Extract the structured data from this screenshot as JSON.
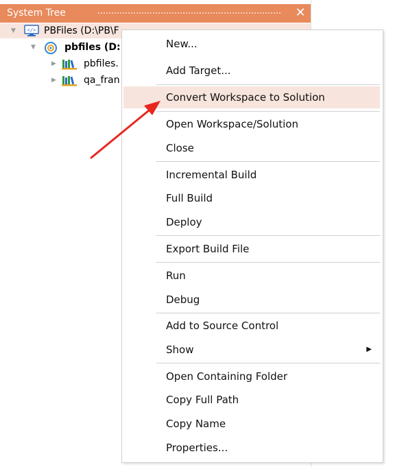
{
  "panel": {
    "title": "System Tree",
    "close_glyph": "✕"
  },
  "tree": {
    "workspace_label": "PBFiles (D:\\PB\\F",
    "target_label": "pbfiles (D:",
    "lib1_label": "pbfiles.",
    "lib2_label": "qa_fran"
  },
  "menu": {
    "items": [
      {
        "label": "New..."
      },
      {
        "label": "Add Target..."
      },
      {
        "label": "Convert Workspace to Solution"
      },
      {
        "label": "Open Workspace/Solution"
      },
      {
        "label": "Close"
      },
      {
        "label": "Incremental Build"
      },
      {
        "label": "Full Build"
      },
      {
        "label": "Deploy"
      },
      {
        "label": "Export Build File"
      },
      {
        "label": "Run"
      },
      {
        "label": "Debug"
      },
      {
        "label": "Add to Source Control"
      },
      {
        "label": "Show"
      },
      {
        "label": "Open Containing Folder"
      },
      {
        "label": "Copy Full Path"
      },
      {
        "label": "Copy Name"
      },
      {
        "label": "Properties..."
      }
    ],
    "submenu_glyph": "▶"
  },
  "colors": {
    "titlebar": "#e88a5c",
    "highlight": "#f7e4dc",
    "annotation_arrow": "#e8261e"
  },
  "icons": {
    "workspace": "workspace-icon",
    "target": "target-icon",
    "library": "library-icon"
  }
}
